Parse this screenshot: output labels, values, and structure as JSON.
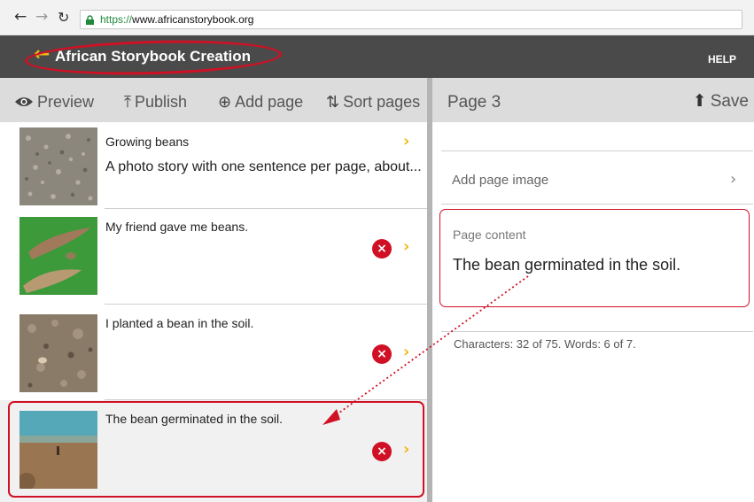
{
  "browser": {
    "back_icon": "arrow-left-icon",
    "forward_icon": "arrow-right-icon",
    "reload_icon": "reload-icon",
    "url_scheme": "https://",
    "url_host": "www.africanstorybook.org"
  },
  "header": {
    "title": "African Storybook Creation",
    "help": "HELP",
    "accent_color": "#f3b816",
    "bar_color": "#4a4a4a"
  },
  "toolbar": {
    "preview": "Preview",
    "publish": "Publish",
    "add_page": "Add page",
    "sort_pages": "Sort pages"
  },
  "pages": [
    {
      "title": "Growing beans",
      "description": "A photo story with one sentence per page, about..."
    },
    {
      "title": "My friend gave me beans."
    },
    {
      "title": "I planted a bean in the soil."
    },
    {
      "title": "The bean germinated in the soil."
    }
  ],
  "editor": {
    "page_title": "Page 3",
    "save": "Save",
    "add_image": "Add page image",
    "content_label": "Page content",
    "content_text": "The bean germinated in the soil.",
    "char_count": "Characters: 32 of 75. Words: 6 of 7."
  },
  "annotation_color": "#d01024"
}
